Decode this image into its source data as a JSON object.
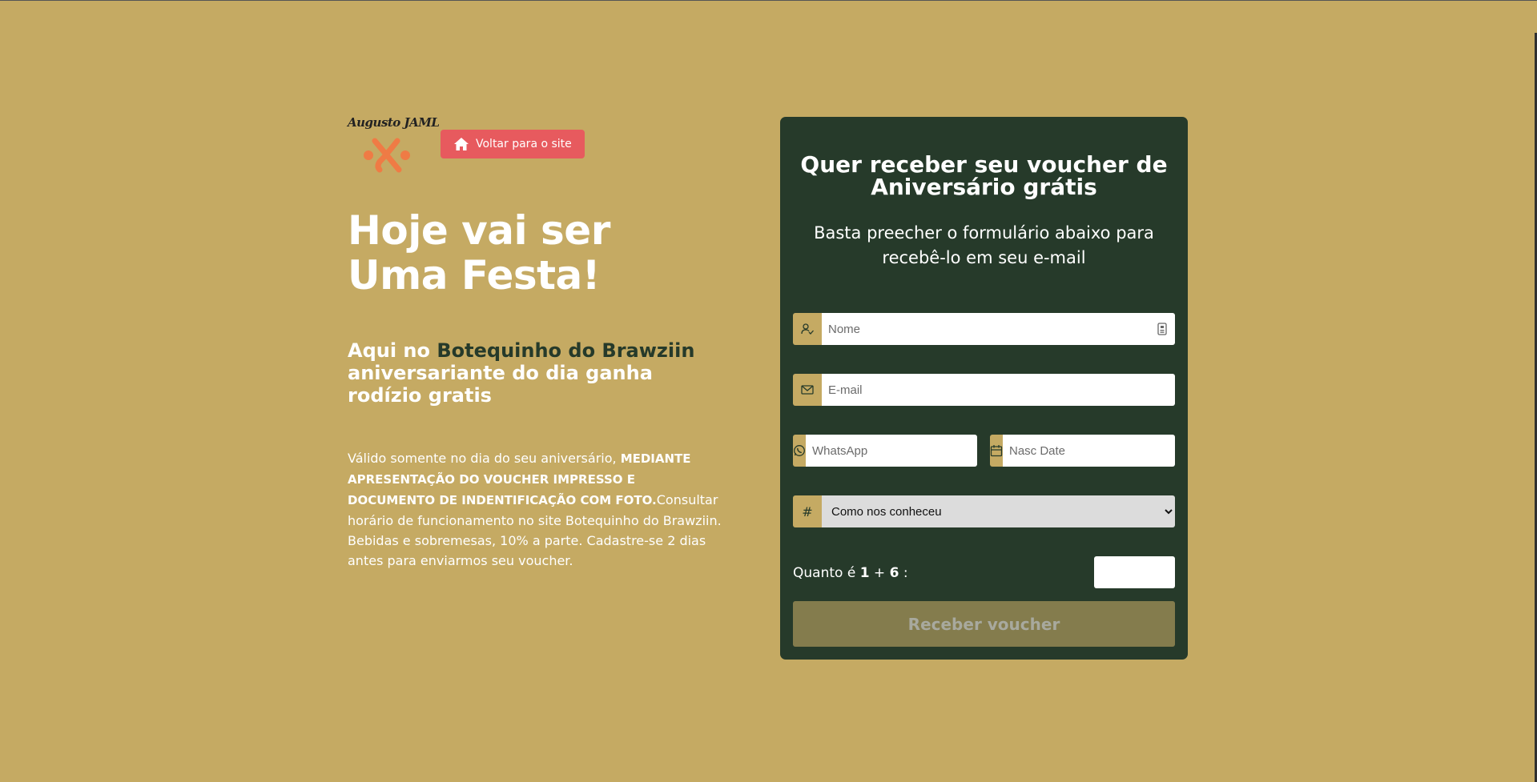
{
  "logo": {
    "text": "Augusto JAML"
  },
  "header": {
    "back_button": "Voltar para o site"
  },
  "hero": {
    "title_line1": "Hoje vai ser",
    "title_line2": "Uma Festa!",
    "subtitle_pre": "Aqui no ",
    "subtitle_brand": "Botequinho do Brawziin",
    "subtitle_post": " aniversariante do dia ganha rodízio gratis",
    "desc_pre": "Válido somente no dia do seu aniversário, ",
    "desc_bold": "MEDIANTE APRESENTAÇÃO DO VOUCHER IMPRESSO E DOCUMENTO DE INDENTIFICAÇÃO COM FOTO.",
    "desc_post": "Consultar horário de funcionamento no site Botequinho do Brawziin. Bebidas e sobremesas, 10% a parte. Cadastre-se 2 dias antes para enviarmos seu voucher."
  },
  "form": {
    "title": "Quer receber seu voucher de Aniversário grátis",
    "subtitle": "Basta preecher o formulário abaixo para recebê-lo em seu e-mail",
    "name_placeholder": "Nome",
    "email_placeholder": "E-mail",
    "whatsapp_placeholder": "WhatsApp",
    "birth_placeholder": "Nasc Date",
    "source_select": {
      "selected": "Como nos conheceu",
      "addon": "#"
    },
    "captcha": {
      "prefix": "Quanto é ",
      "a": "1",
      "op": " + ",
      "b": "6",
      "suffix": " :"
    },
    "submit_label": "Receber voucher"
  },
  "colors": {
    "background": "#c5aa63",
    "panel": "#263a2a",
    "back_button": "#e75a5e",
    "submit": "#847c4d",
    "logo_accent": "#ef7b45"
  }
}
